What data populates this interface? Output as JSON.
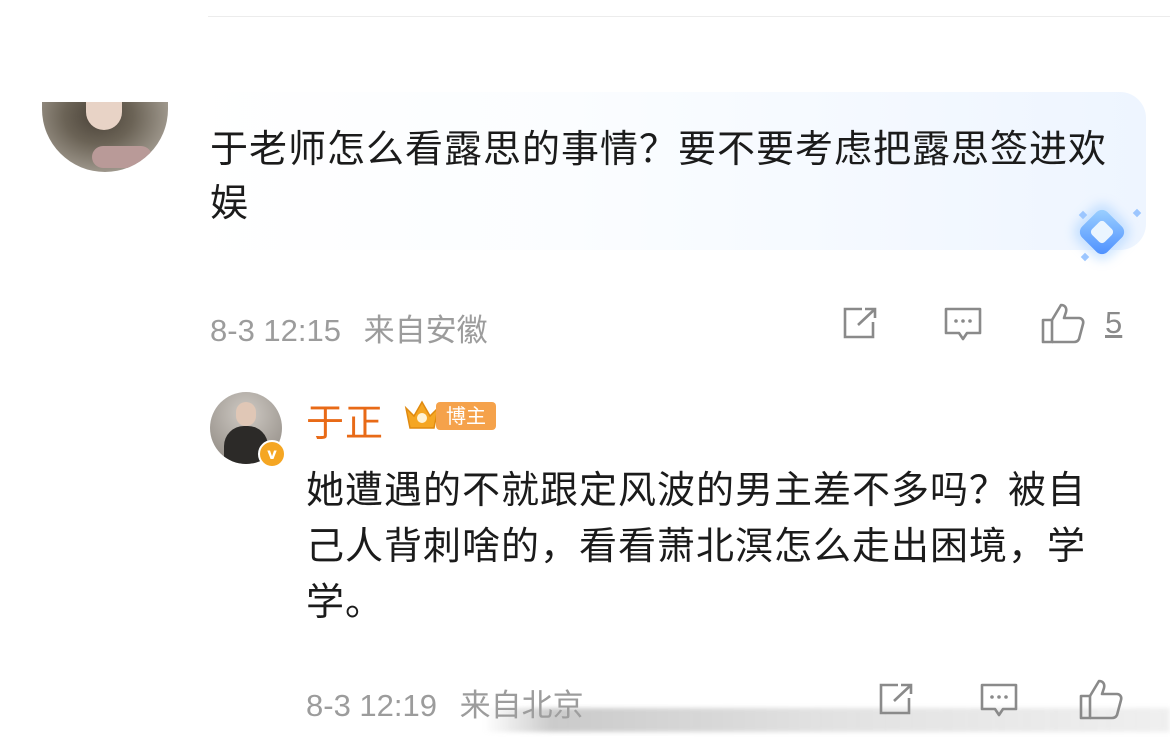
{
  "comment": {
    "text": "于老师怎么看露思的事情？要不要考虑把露思签进欢娱",
    "time": "8-3 12:15",
    "location": "来自安徽",
    "like_count": "5"
  },
  "reply": {
    "username": "于正",
    "badge_label": "博主",
    "verified_mark": "v",
    "text": "她遭遇的不就跟定风波的男主差不多吗？被自己人背刺啥的，看看萧北溟怎么走出困境，学学。",
    "time": "8-3 12:19",
    "location": "来自北京"
  },
  "colors": {
    "username": "#e86a17",
    "badge": "#f5a24b",
    "meta": "#9c9c9c",
    "text": "#1b1b1b"
  },
  "icons": [
    "share-icon",
    "comment-icon",
    "like-icon",
    "diamond-badge-icon",
    "verified-icon",
    "crown-icon"
  ]
}
